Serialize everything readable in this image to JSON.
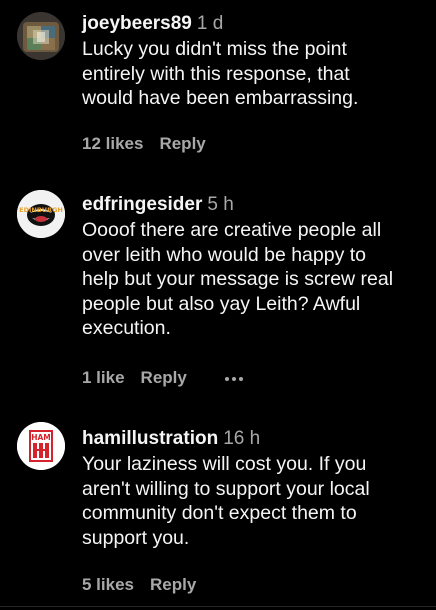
{
  "comments": [
    {
      "username": "joeybeers89",
      "time": "1 d",
      "lines": [
        "Lucky you didn't miss the point",
        "entirely with this response, that",
        "would have been embarrassing."
      ],
      "likes": "12 likes",
      "reply": "Reply",
      "avatar_icon": "glitter-profile-photo-icon"
    },
    {
      "username": "edfringesider",
      "time": "5 h",
      "lines": [
        "Oooof there are creative people all",
        "over leith who would be happy to",
        "help but your message is screw real",
        "people but also yay Leith? Awful",
        "execution."
      ],
      "likes": "1 like",
      "reply": "Reply",
      "more_icon": "more-options-icon",
      "avatar_icon": "mouth-logo-icon",
      "avatar_text": "EDINBURGH"
    },
    {
      "username": "hamillustration",
      "time": "16 h",
      "lines": [
        "Your laziness will cost you. If you",
        "aren't willing to support your local",
        "community don't expect them to",
        "support you."
      ],
      "likes": "5 likes",
      "reply": "Reply",
      "avatar_icon": "ham-logo-icon",
      "avatar_text": "HAM"
    }
  ],
  "colors": {
    "background": "#000000",
    "primary_text": "#f5f5f5",
    "secondary_text": "#a8a8a8",
    "ham_red": "#d4232a"
  }
}
